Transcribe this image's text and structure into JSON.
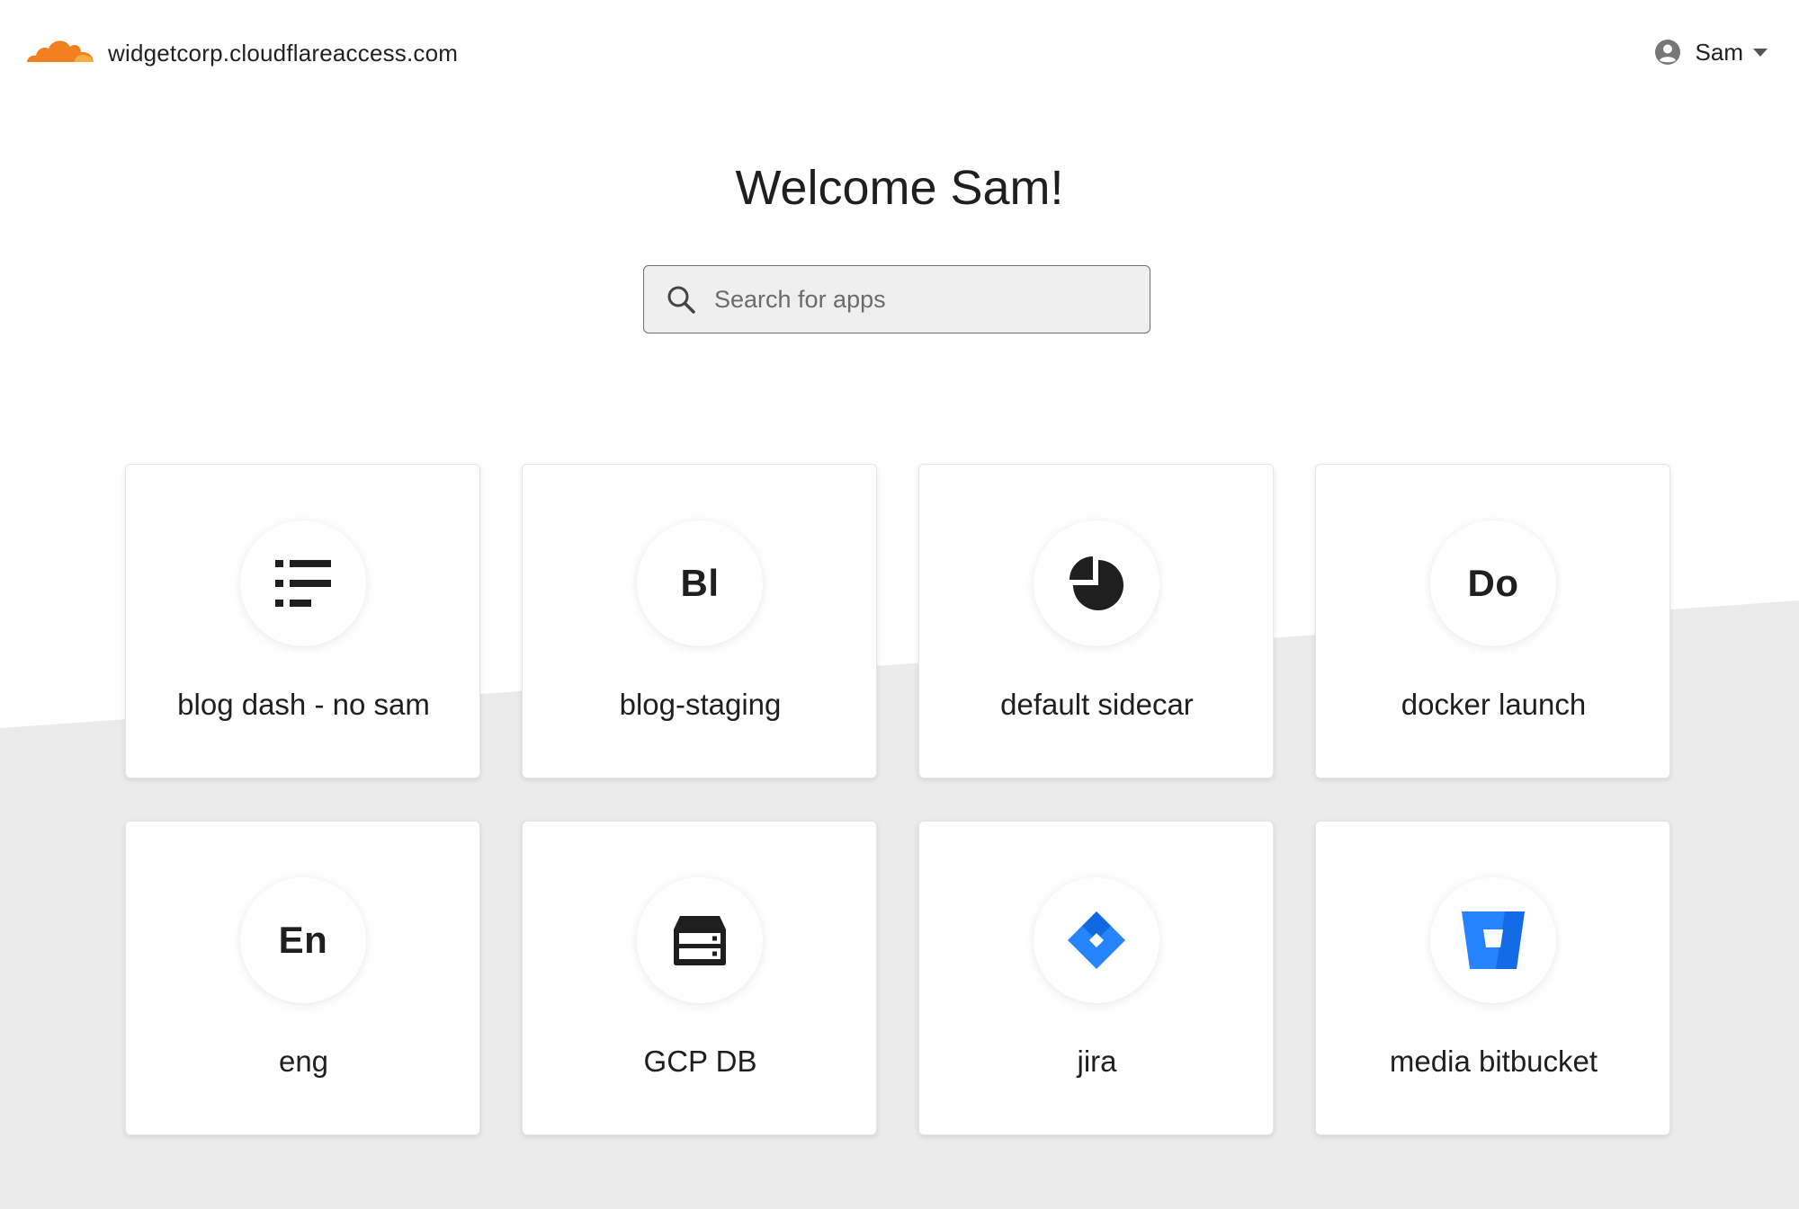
{
  "header": {
    "logo_icon": "cloudflare-cloud-icon",
    "domain": "widgetcorp.cloudflareaccess.com",
    "user": {
      "icon": "user-circle-icon",
      "name": "Sam",
      "caret_icon": "caret-down-icon"
    }
  },
  "main": {
    "welcome": "Welcome Sam!",
    "search": {
      "icon": "search-icon",
      "placeholder": "Search for apps",
      "value": ""
    }
  },
  "apps": [
    {
      "name": "blog dash - no sam",
      "icon": "list-icon",
      "abbr": ""
    },
    {
      "name": "blog-staging",
      "icon": "",
      "abbr": "Bl"
    },
    {
      "name": "default sidecar",
      "icon": "pie-chart-icon",
      "abbr": ""
    },
    {
      "name": "docker launch",
      "icon": "",
      "abbr": "Do"
    },
    {
      "name": "eng",
      "icon": "",
      "abbr": "En"
    },
    {
      "name": "GCP DB",
      "icon": "server-icon",
      "abbr": ""
    },
    {
      "name": "jira",
      "icon": "jira-icon",
      "abbr": ""
    },
    {
      "name": "media bitbucket",
      "icon": "bitbucket-icon",
      "abbr": ""
    }
  ],
  "colors": {
    "brand_orange": "#f38020",
    "brand_orange_light": "#faad3f",
    "background_band": "#ebebeb",
    "atlassian_blue": "#2684ff",
    "atlassian_blue_dark": "#0052cc",
    "text_dark": "#1f1f1f"
  }
}
